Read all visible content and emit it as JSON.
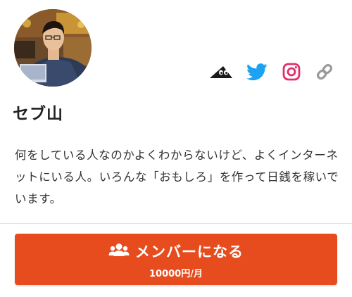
{
  "profile": {
    "name": "セブ山",
    "bio": "何をしている人なのかよくわからないけど、よくインターネットにいる人。いろんな「おもしろ」を作って日銭を稼いでいます。"
  },
  "social_links": [
    {
      "icon": "hatena-blog-icon",
      "color": "#1a1a1a"
    },
    {
      "icon": "twitter-icon",
      "color": "#1da1f2"
    },
    {
      "icon": "instagram-icon",
      "color": "#e1306c"
    },
    {
      "icon": "link-icon",
      "color": "#9a9a9a"
    }
  ],
  "membership": {
    "button_label": "メンバーになる",
    "price": "10000円/月",
    "icon": "users-icon",
    "color": "#e64c1e"
  }
}
